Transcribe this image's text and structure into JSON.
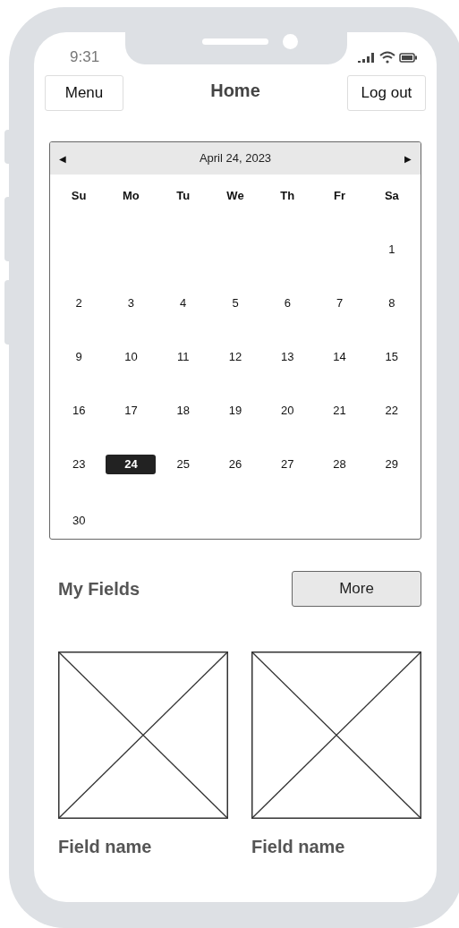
{
  "status_bar": {
    "time": "9:31"
  },
  "header": {
    "left_button": "Menu",
    "title": "Home",
    "right_button": "Log out"
  },
  "calendar": {
    "prev": "◀",
    "title": "April 24, 2023",
    "next": "▶",
    "weekdays": [
      "Su",
      "Mo",
      "Tu",
      "We",
      "Th",
      "Fr",
      "Sa"
    ],
    "weeks": [
      {
        "days": [
          {
            "label": "1",
            "selected": false
          }
        ]
      },
      {
        "days": [
          {
            "label": "2",
            "selected": false
          },
          {
            "label": "3",
            "selected": false
          },
          {
            "label": "4",
            "selected": false
          },
          {
            "label": "5",
            "selected": false
          },
          {
            "label": "6",
            "selected": false
          },
          {
            "label": "7",
            "selected": false
          },
          {
            "label": "8",
            "selected": false
          }
        ]
      },
      {
        "days": [
          {
            "label": "9",
            "selected": false
          },
          {
            "label": "10",
            "selected": false
          },
          {
            "label": "11",
            "selected": false
          },
          {
            "label": "12",
            "selected": false
          },
          {
            "label": "13",
            "selected": false
          },
          {
            "label": "14",
            "selected": false
          },
          {
            "label": "15",
            "selected": false
          }
        ]
      },
      {
        "days": [
          {
            "label": "16",
            "selected": false
          },
          {
            "label": "17",
            "selected": false
          },
          {
            "label": "18",
            "selected": false
          },
          {
            "label": "19",
            "selected": false
          },
          {
            "label": "20",
            "selected": false
          },
          {
            "label": "21",
            "selected": false
          },
          {
            "label": "22",
            "selected": false
          }
        ]
      },
      {
        "days": [
          {
            "label": "23",
            "selected": false
          },
          {
            "label": "24",
            "selected": true
          },
          {
            "label": "25",
            "selected": false
          },
          {
            "label": "26",
            "selected": false
          },
          {
            "label": "27",
            "selected": false
          },
          {
            "label": "28",
            "selected": false
          },
          {
            "label": "29",
            "selected": false
          }
        ]
      },
      {
        "days": [
          {
            "label": "30",
            "selected": false
          }
        ]
      }
    ]
  },
  "section": {
    "title": "My Fields",
    "button": "More"
  },
  "fields": [
    {
      "name": "Field name"
    },
    {
      "name": "Field name"
    }
  ]
}
